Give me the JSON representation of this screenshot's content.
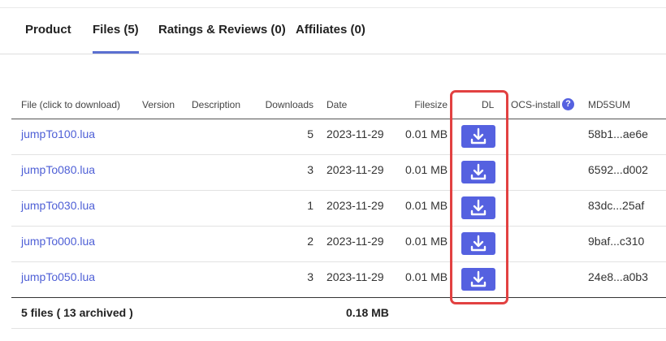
{
  "tabs": [
    {
      "label": "Product"
    },
    {
      "label": "Files (5)"
    },
    {
      "label": "Ratings & Reviews (0)"
    },
    {
      "label": "Affiliates (0)"
    }
  ],
  "active_tab": "Files (5)",
  "table": {
    "headers": {
      "file": "File (click to download)",
      "version": "Version",
      "description": "Description",
      "downloads": "Downloads",
      "date": "Date",
      "filesize": "Filesize",
      "dl": "DL",
      "ocs": "OCS-install",
      "ocs_help": "?",
      "md5": "MD5SUM"
    },
    "rows": [
      {
        "file": "jumpTo100.lua",
        "downloads": "5",
        "date": "2023-11-29",
        "filesize": "0.01 MB",
        "md5": "58b1...ae6e"
      },
      {
        "file": "jumpTo080.lua",
        "downloads": "3",
        "date": "2023-11-29",
        "filesize": "0.01 MB",
        "md5": "6592...d002"
      },
      {
        "file": "jumpTo030.lua",
        "downloads": "1",
        "date": "2023-11-29",
        "filesize": "0.01 MB",
        "md5": "83dc...25af"
      },
      {
        "file": "jumpTo000.lua",
        "downloads": "2",
        "date": "2023-11-29",
        "filesize": "0.01 MB",
        "md5": "9baf...c310"
      },
      {
        "file": "jumpTo050.lua",
        "downloads": "3",
        "date": "2023-11-29",
        "filesize": "0.01 MB",
        "md5": "24e8...a0b3"
      }
    ],
    "footer": {
      "files": "5 files ( 13 archived )",
      "total_size": "0.18 MB"
    }
  },
  "colors": {
    "accent": "#5561e0",
    "link": "#4e5fd6",
    "tab_underline": "#5b6fd1",
    "highlight_box": "#e24141"
  },
  "icons": {
    "download": "download-icon",
    "help": "question-circle-icon"
  }
}
